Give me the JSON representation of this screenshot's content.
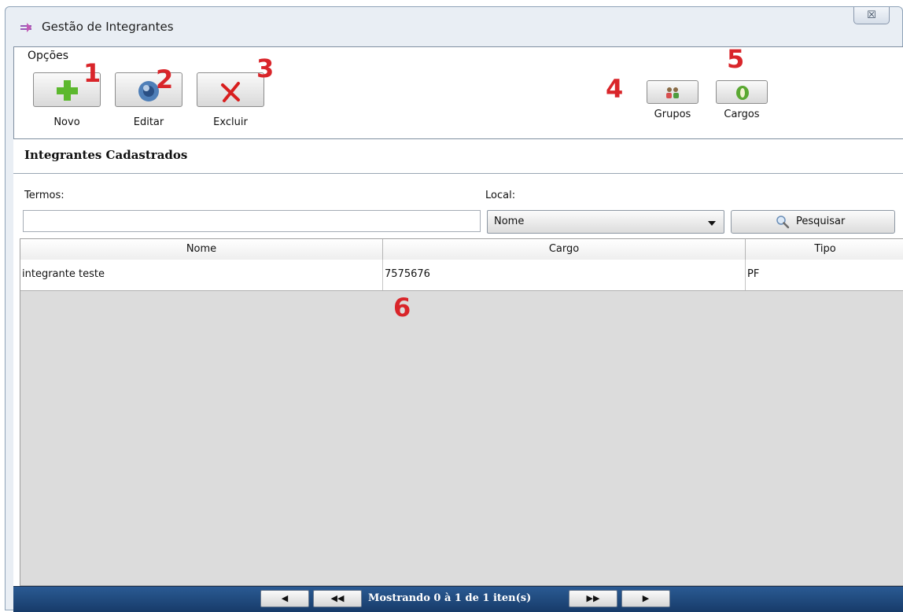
{
  "window": {
    "title": "Gestão de Integrantes",
    "close_glyph": "☒"
  },
  "toolbar": {
    "group_label": "Opções",
    "novo_label": "Novo",
    "editar_label": "Editar",
    "excluir_label": "Excluir",
    "grupos_label": "Grupos",
    "cargos_label": "Cargos"
  },
  "annotations": [
    "1",
    "2",
    "3",
    "4",
    "5",
    "6"
  ],
  "section": {
    "title": "Integrantes Cadastrados"
  },
  "search": {
    "termos_label": "Termos:",
    "termos_value": "",
    "local_label": "Local:",
    "local_selected": "Nome",
    "search_button_label": "Pesquisar"
  },
  "table": {
    "columns": [
      "Nome",
      "Cargo",
      "Tipo"
    ],
    "rows": [
      [
        "integrante teste",
        "7575676",
        "PF"
      ]
    ]
  },
  "pager": {
    "info": "Mostrando 0 à 1 de 1 iten(s)",
    "prev_glyph": "◀",
    "first_glyph": "◀◀",
    "next_glyph": "▶▶",
    "last_glyph": "▶"
  },
  "colors": {
    "annotation_red": "#d9252a",
    "pager_bar": "#1f4a7e",
    "novo_icon_green": "#5cb82e",
    "excluir_icon_red": "#d81f1f"
  },
  "icons": {
    "app": "window-app-icon",
    "novo": "plus-icon",
    "editar": "refresh-icon",
    "excluir": "x-icon",
    "grupos": "group-people-icon",
    "cargos": "badge-icon",
    "search": "magnifier-icon"
  }
}
